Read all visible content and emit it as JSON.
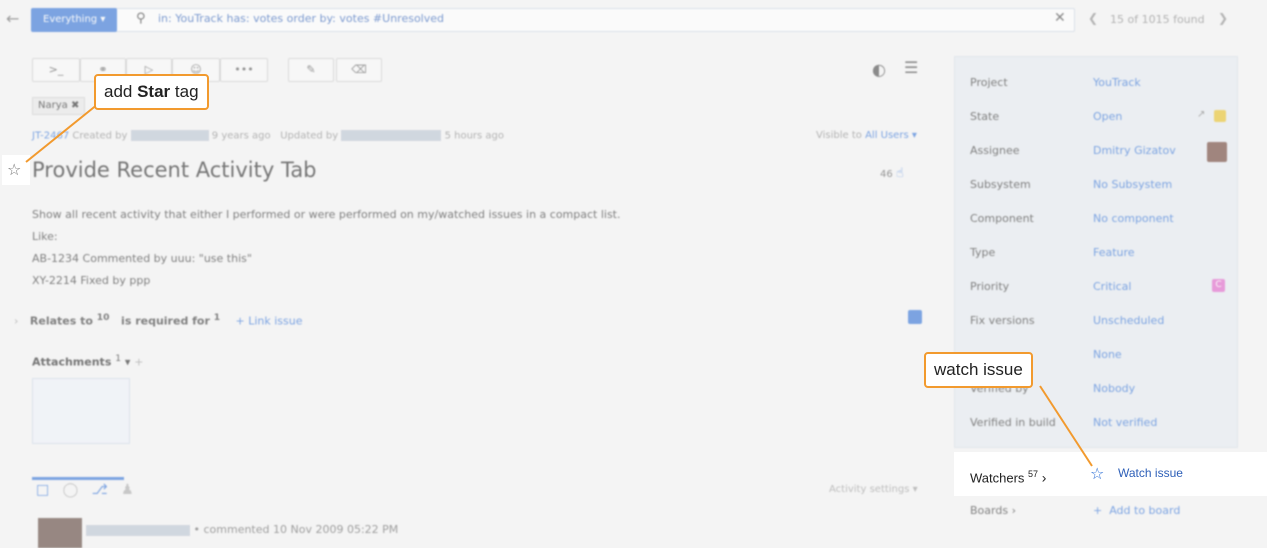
{
  "search": {
    "scope": "Everything",
    "query": "in: YouTrack has: votes order by: votes #Unresolved",
    "result_count": "15 of 1015 found"
  },
  "toolbar": {
    "command": ">_",
    "more": "•••"
  },
  "issue": {
    "tag": "Narya ✖",
    "id": "JT-2467",
    "created_prefix": "Created by",
    "created_ago": "9 years ago",
    "updated_prefix": "Updated by",
    "updated_ago": "5 hours ago",
    "visible_to_label": "Visible to",
    "visible_to": "All Users ▾",
    "title": "Provide Recent Activity Tab",
    "votes": "46",
    "description": [
      "Show all recent activity that either I performed or were performed on my/watched issues in a compact list.",
      "Like:",
      "AB-1234 Commented by uuu: \"use this\"",
      "XY-2214 Fixed by ppp"
    ],
    "relates_to": "Relates to",
    "relates_to_count": "10",
    "is_required_for": "is required for",
    "is_required_for_count": "1",
    "link_issue": "Link issue",
    "attachments": "Attachments",
    "attachments_count": "1",
    "activity_settings": "Activity settings ▾",
    "comment_text": "commented 10 Nov 2009 05:22 PM"
  },
  "fields": [
    {
      "label": "Project",
      "value": "YouTrack"
    },
    {
      "label": "State",
      "value": "Open"
    },
    {
      "label": "Assignee",
      "value": "Dmitry Gizatov"
    },
    {
      "label": "Subsystem",
      "value": "No Subsystem"
    },
    {
      "label": "Component",
      "value": "No component"
    },
    {
      "label": "Type",
      "value": "Feature"
    },
    {
      "label": "Priority",
      "value": "Critical"
    },
    {
      "label": "Fix versions",
      "value": "Unscheduled"
    },
    {
      "label": "",
      "value": "None"
    },
    {
      "label": "Verified by",
      "value": "Nobody"
    },
    {
      "label": "Verified in build",
      "value": "Not verified"
    }
  ],
  "priority_badge": "C",
  "watchers": {
    "label": "Watchers",
    "count": "57",
    "watch_link": "Watch issue"
  },
  "boards": {
    "label": "Boards",
    "add_link": "Add to board"
  },
  "callouts": {
    "star_prefix": "add ",
    "star_bold": "Star",
    "star_suffix": " tag",
    "watch": "watch issue"
  },
  "colors": {
    "accent": "#2d6fd6",
    "callout_border": "#f29a2e"
  }
}
